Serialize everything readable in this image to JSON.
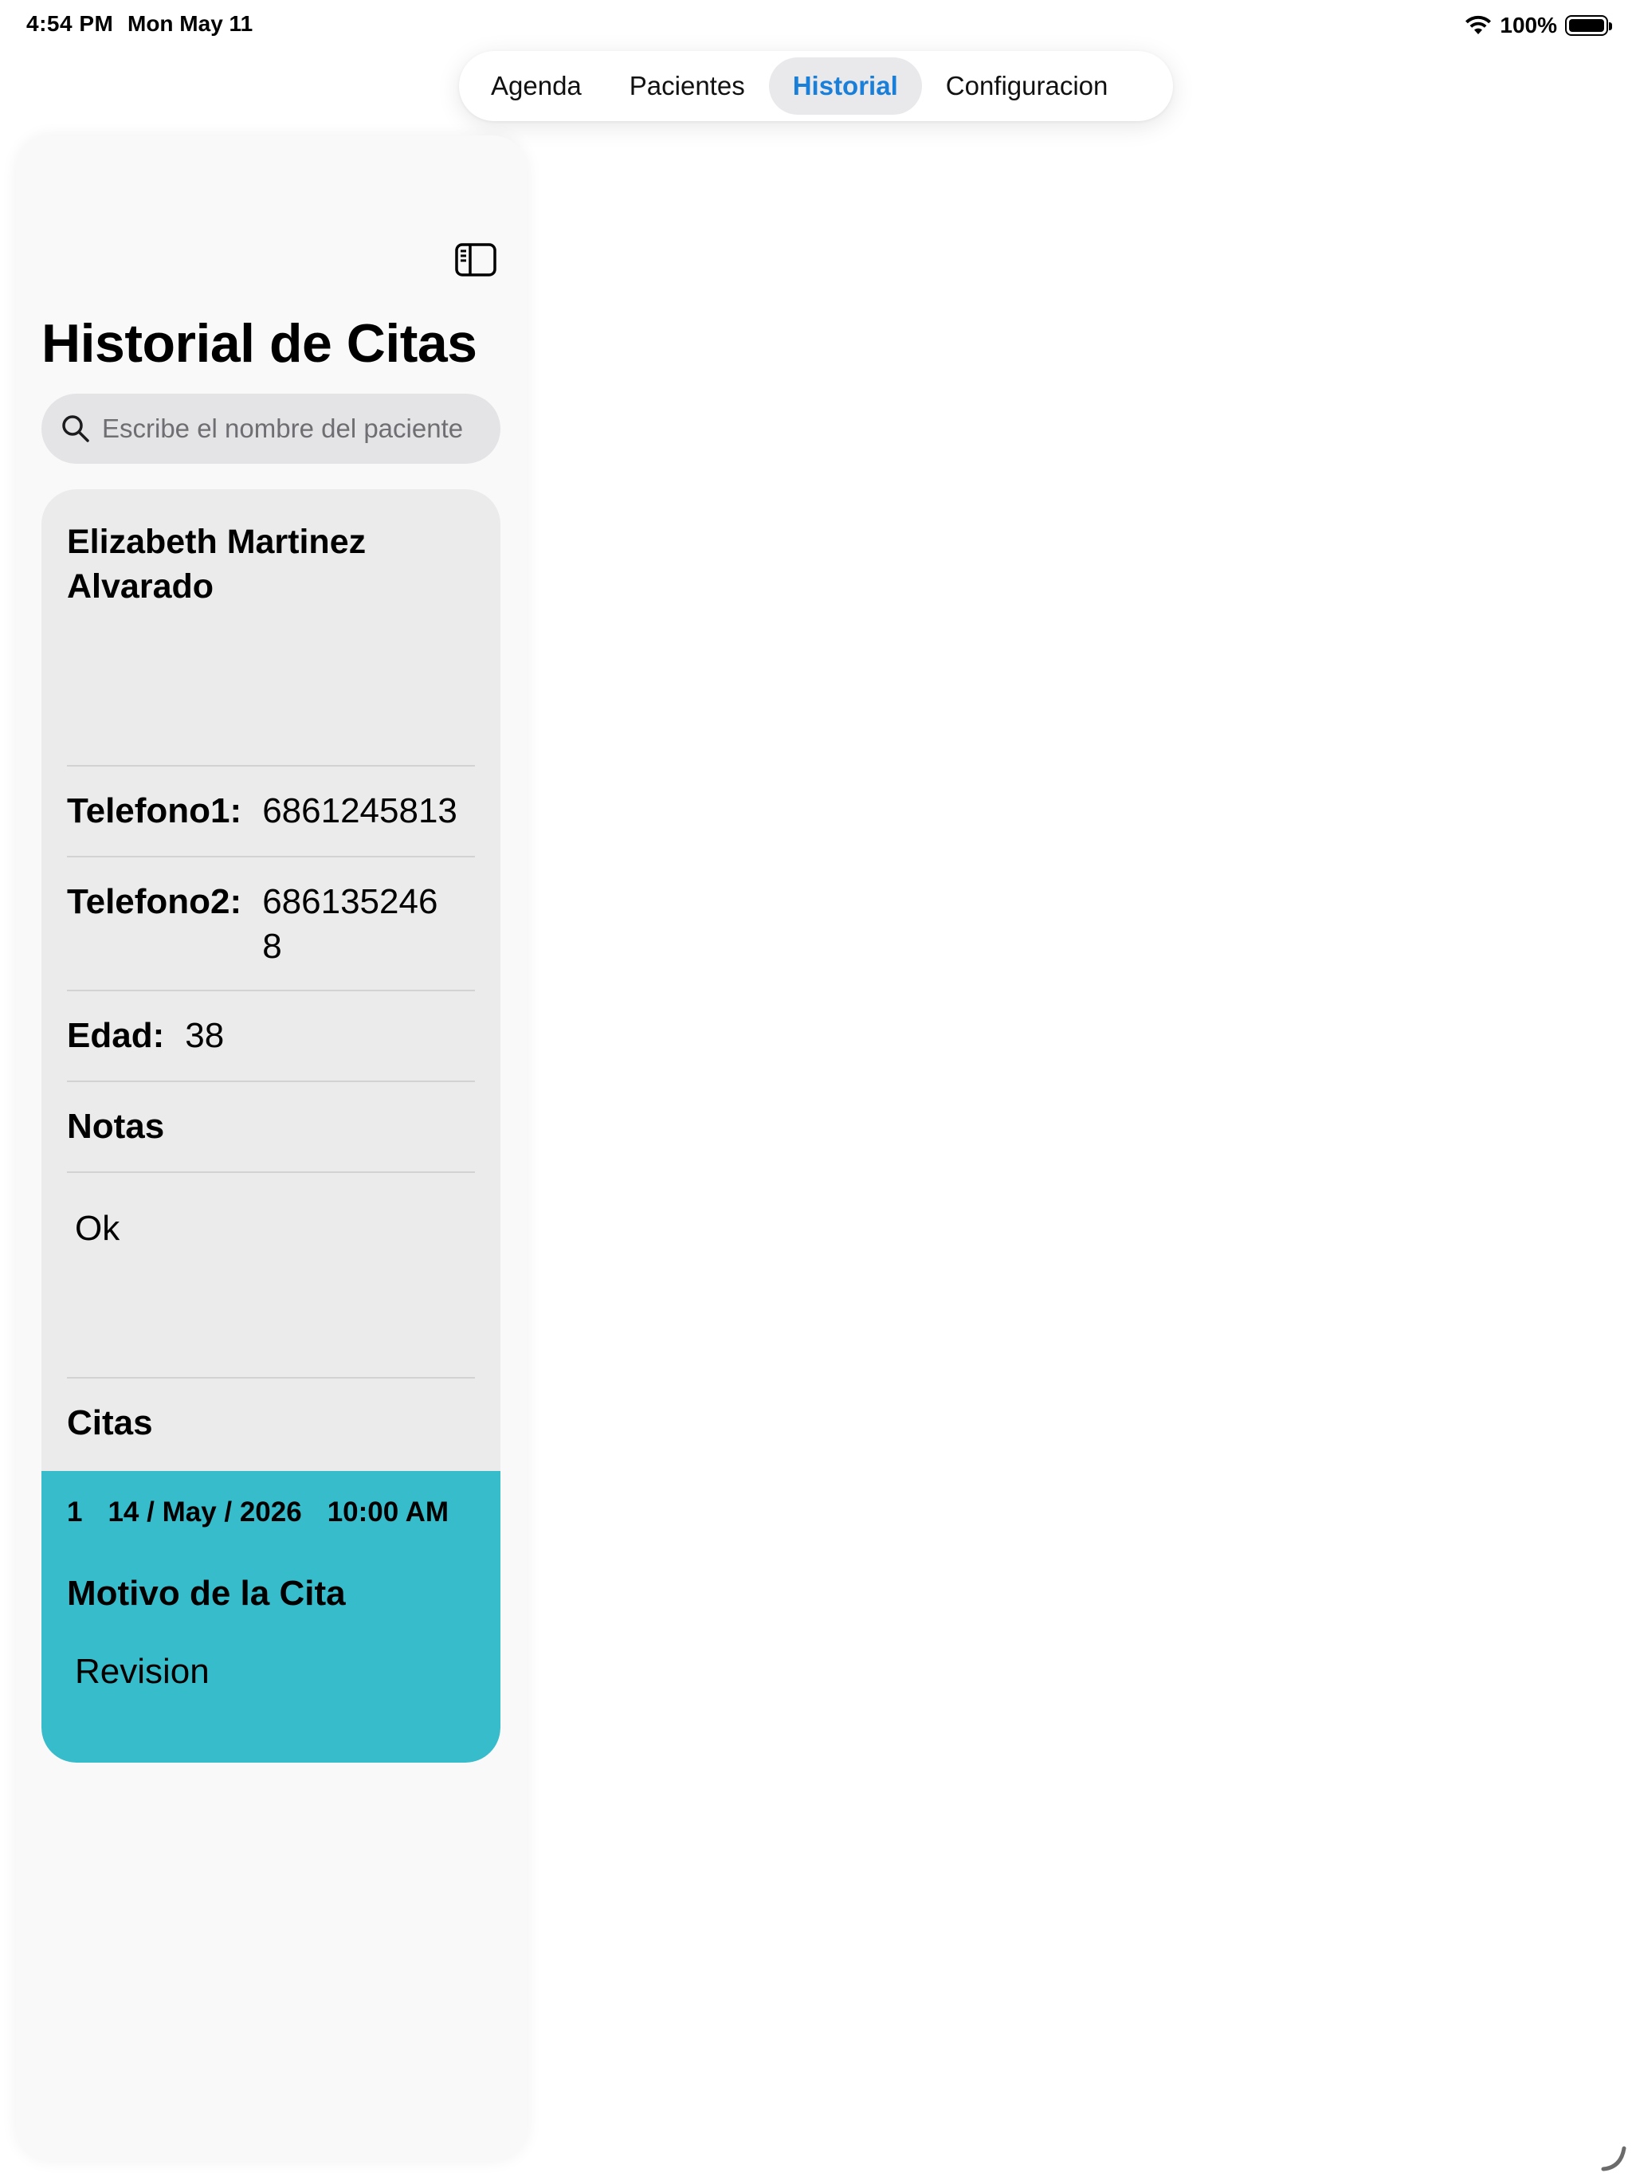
{
  "status_bar": {
    "time": "4:54 PM",
    "date": "Mon May 11",
    "battery_percent": "100%",
    "icons": [
      "wifi-icon",
      "battery-icon"
    ]
  },
  "tabs": [
    {
      "label": "Agenda",
      "selected": false
    },
    {
      "label": "Pacientes",
      "selected": false
    },
    {
      "label": "Historial",
      "selected": true
    },
    {
      "label": "Configuracion",
      "selected": false
    }
  ],
  "colors": {
    "accent": "#1a7fd8",
    "cita_card": "#36bccb",
    "patient_card": "#ebebeb"
  },
  "sidebar": {
    "title": "Historial de Citas",
    "search": {
      "placeholder": "Escribe el nombre del paciente",
      "value": ""
    }
  },
  "patient": {
    "name": "Elizabeth Martinez Alvarado",
    "telefono1_label": "Telefono1:",
    "telefono1": "6861245813",
    "telefono2_label": "Telefono2:",
    "telefono2": "6861352468",
    "edad_label": "Edad:",
    "edad": "38",
    "notas_label": "Notas",
    "notas": "Ok",
    "citas_label": "Citas"
  },
  "citas": [
    {
      "number": "1",
      "date": "14 / May / 2026",
      "time": "10:00 AM",
      "motivo_label": "Motivo de la Cita",
      "motivo": "Revision"
    }
  ]
}
